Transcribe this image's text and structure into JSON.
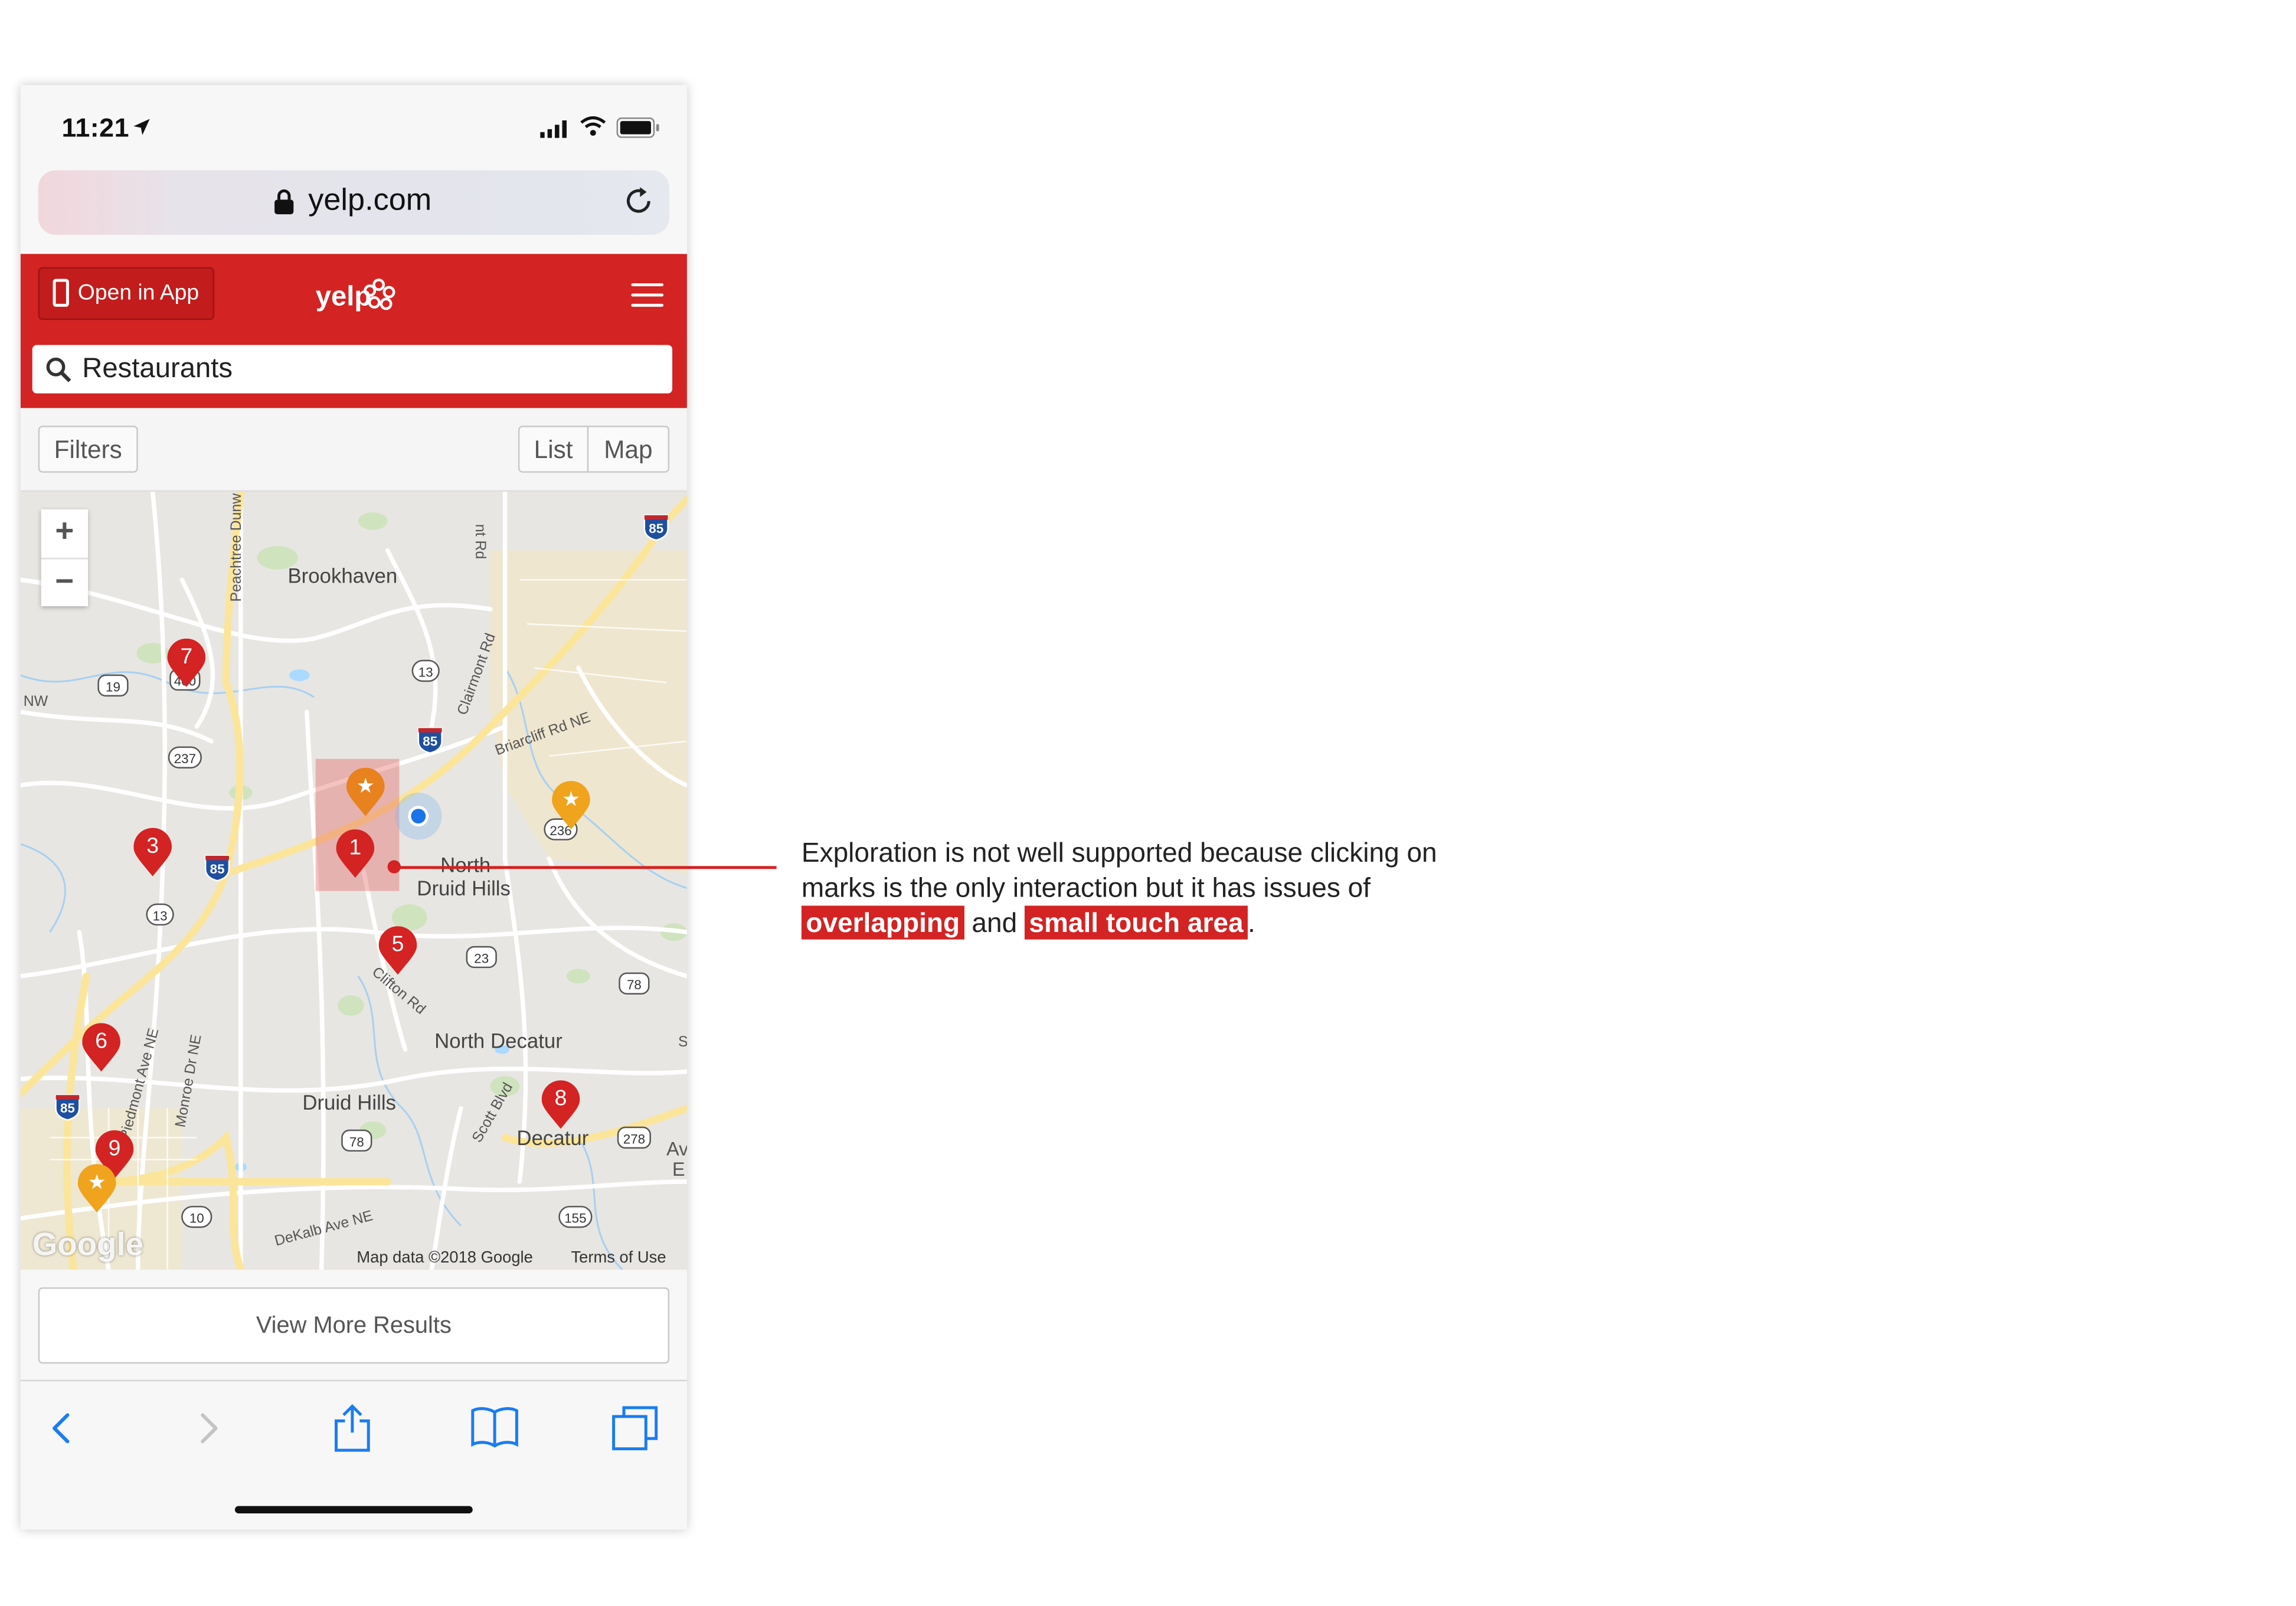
{
  "status_bar": {
    "time": "11:21"
  },
  "browser": {
    "url": "yelp.com"
  },
  "yelp_header": {
    "open_in_app": "Open in App",
    "logo_text": "yelp",
    "search_value": "Restaurants"
  },
  "filter_bar": {
    "filters": "Filters",
    "list": "List",
    "map": "Map"
  },
  "map": {
    "zoom_in": "+",
    "zoom_out": "−",
    "places": [
      "Brookhaven",
      "North",
      "Druid Hills",
      "North Decatur",
      "Druid Hills",
      "Decatur"
    ],
    "roads": [
      "Peachtree Dunw",
      "nt Rd",
      "Clairmont Rd",
      "Briarcliff Rd NE",
      "Clifton Rd",
      "Piedmont Ave NE",
      "Monroe Dr NE",
      "Scott Blvd",
      "DeKalb Ave NE",
      "NW",
      "S",
      "Av",
      "E"
    ],
    "highway_shields": [
      "85",
      "85",
      "85",
      "85",
      "19",
      "400",
      "237",
      "13",
      "13",
      "236",
      "23",
      "78",
      "78",
      "278",
      "155",
      "10"
    ],
    "markers": [
      {
        "label": "1",
        "kind": "numbered"
      },
      {
        "label": "3",
        "kind": "numbered"
      },
      {
        "label": "5",
        "kind": "numbered"
      },
      {
        "label": "6",
        "kind": "numbered"
      },
      {
        "label": "7",
        "kind": "numbered"
      },
      {
        "label": "8",
        "kind": "numbered"
      },
      {
        "label": "9",
        "kind": "numbered"
      },
      {
        "label": "★",
        "kind": "star"
      },
      {
        "label": "★",
        "kind": "star"
      },
      {
        "label": "★",
        "kind": "star"
      }
    ],
    "google_logo": "Google",
    "map_data": "Map data ©2018 Google",
    "terms": "Terms of Use"
  },
  "view_more": "View More Results",
  "annotation": {
    "text_1": "Exploration is not well supported because clicking on marks is the only interaction but it has issues of",
    "highlight_1": "overlapping",
    "text_2": "and",
    "highlight_2": "small touch area",
    "text_3": "."
  },
  "colors": {
    "yelp_red": "#d32323",
    "star_orange": "#f0a31c",
    "user_location": "#1a73e8",
    "ios_blue": "#1a7cf1"
  },
  "icons": [
    "location-arrow-icon",
    "signal-icon",
    "wifi-icon",
    "battery-icon",
    "lock-icon",
    "reload-icon",
    "phone-icon",
    "menu-icon",
    "search-icon",
    "back-icon",
    "forward-icon",
    "share-icon",
    "bookmarks-icon",
    "tabs-icon"
  ]
}
